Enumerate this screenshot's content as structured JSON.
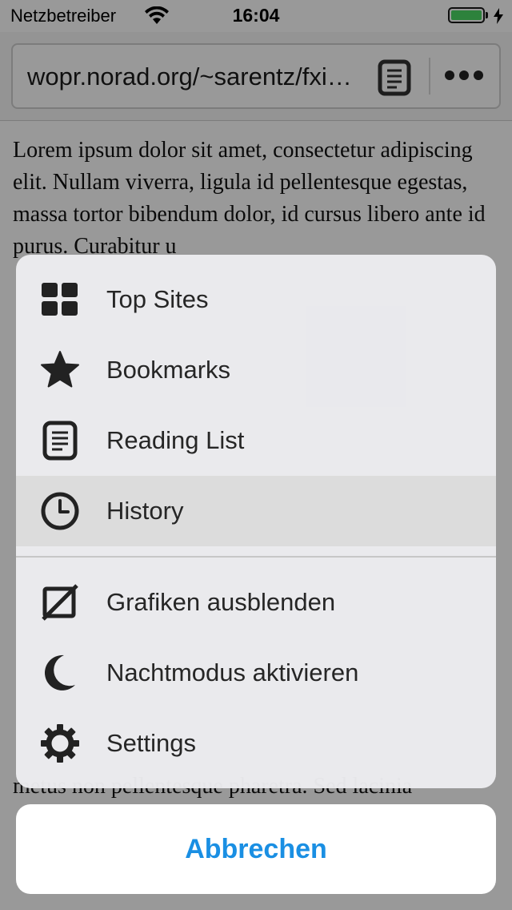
{
  "status_bar": {
    "carrier": "Netzbetreiber",
    "time": "16:04",
    "battery_level": 1.0
  },
  "browser": {
    "url": "wopr.norad.org/~sarentz/fxi…"
  },
  "page": {
    "paragraphs": [
      "Lorem ipsum dolor sit amet, consectetur adipiscing elit. Nullam viverra, ligula id pellentesque egestas, massa tortor bibendum dolor, id cursus libero ante id purus. Curabitur u",
      "metus non pellentesque pharetra. Sed lacinia"
    ]
  },
  "menu": {
    "items": [
      {
        "label": "Top Sites",
        "icon": "grid-icon"
      },
      {
        "label": "Bookmarks",
        "icon": "star-icon"
      },
      {
        "label": "Reading List",
        "icon": "reading-list-icon"
      },
      {
        "label": "History",
        "icon": "clock-icon",
        "highlighted": true
      },
      {
        "label": "Grafiken ausblenden",
        "icon": "hide-images-icon"
      },
      {
        "label": "Nachtmodus aktivieren",
        "icon": "moon-icon"
      },
      {
        "label": "Settings",
        "icon": "gear-icon"
      }
    ],
    "cancel_label": "Abbrechen"
  },
  "colors": {
    "accent": "#1a8fe3",
    "battery": "#4cd964",
    "highlight": "#dcdcdc"
  }
}
